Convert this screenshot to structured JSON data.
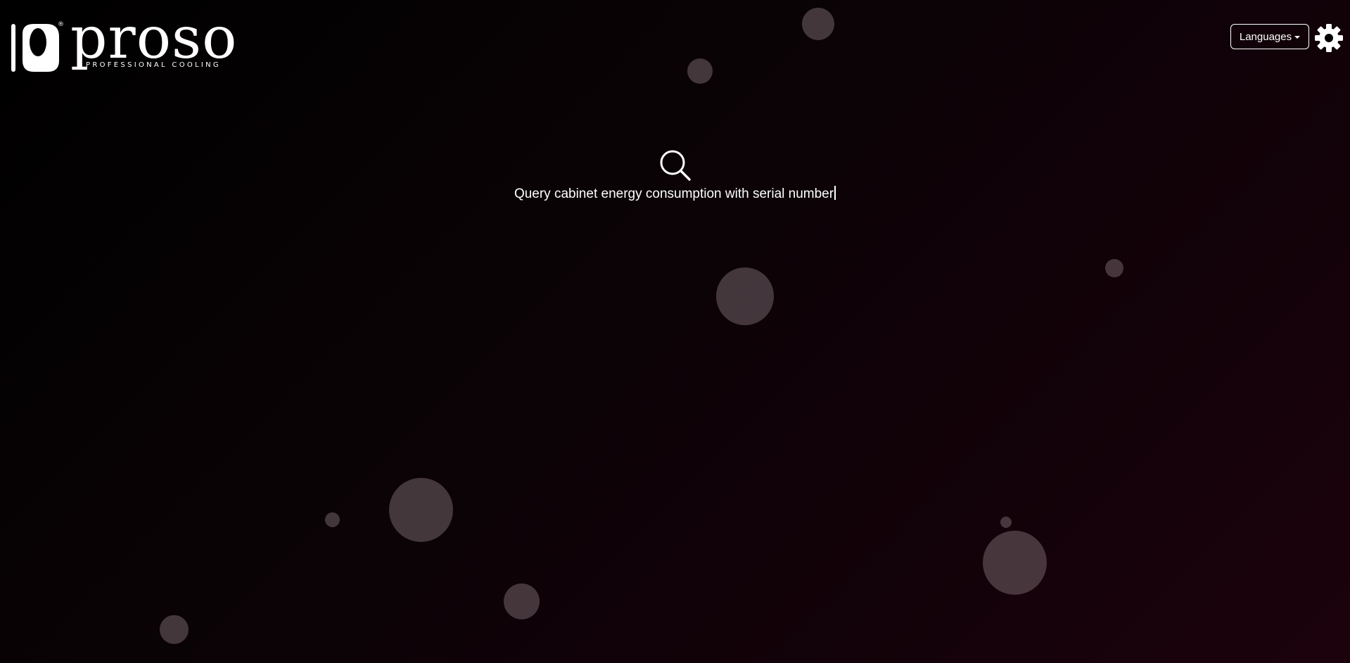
{
  "brand": {
    "name": "proso",
    "tagline": "PROFESSIONAL COOLING",
    "registered_mark": "®"
  },
  "header": {
    "languages_label": "Languages",
    "languages_icon": "caret-down-icon",
    "settings_icon": "gear-icon"
  },
  "search": {
    "icon": "search-icon",
    "query_text": "Query cabinet energy consumption with serial number"
  },
  "colors": {
    "background_dark": "#000000",
    "background_accent": "#1c020d",
    "bubble": "#5a4c52",
    "foreground": "#ffffff"
  }
}
